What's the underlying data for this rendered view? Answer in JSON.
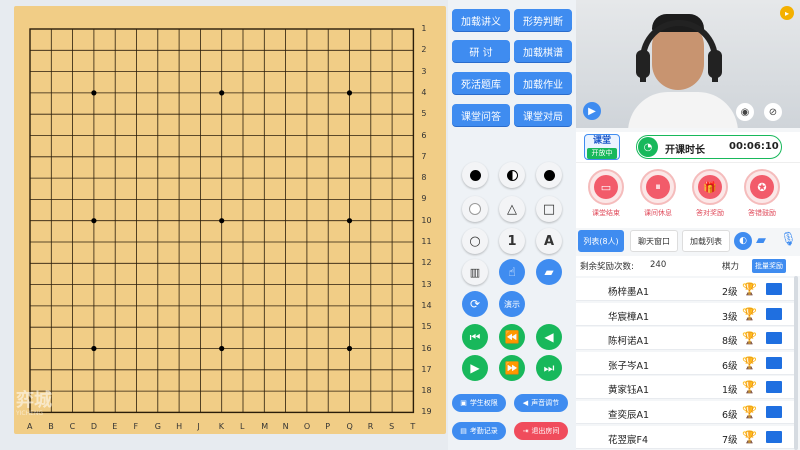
{
  "board": {
    "columns": [
      "A",
      "B",
      "C",
      "D",
      "E",
      "F",
      "G",
      "H",
      "J",
      "K",
      "L",
      "M",
      "N",
      "O",
      "P",
      "Q",
      "R",
      "S",
      "T"
    ],
    "rows": [
      "1",
      "2",
      "3",
      "4",
      "5",
      "6",
      "7",
      "8",
      "9",
      "10",
      "11",
      "12",
      "13",
      "14",
      "15",
      "16",
      "17",
      "18",
      "19"
    ],
    "hoshi": [
      "D4",
      "K4",
      "Q4",
      "D10",
      "K10",
      "Q10",
      "D16",
      "K16",
      "Q16"
    ],
    "colors": {
      "wood": "#f1cd86",
      "line": "#2a1d0a"
    }
  },
  "controls": {
    "buttons": [
      {
        "label": "加载讲义"
      },
      {
        "label": "形势判断"
      },
      {
        "label": "研 讨"
      },
      {
        "label": "加载棋谱"
      },
      {
        "label": "死活题库"
      },
      {
        "label": "加载作业"
      },
      {
        "label": "课堂问答"
      },
      {
        "label": "课堂对局"
      }
    ],
    "tools": {
      "black_stone_icon": "black-stone-icon",
      "alternate_icon": "alternate-stones-icon",
      "white_stone_icon": "white-stone-icon",
      "circle_marker": "●",
      "triangle_marker": "△",
      "square_marker": "□",
      "ring_marker": "○",
      "number_marker": "1",
      "letter_marker": "A",
      "demo_label": "演示"
    },
    "bottom": {
      "permissions": "学生权限",
      "volume": "声音调节",
      "attendance": "考勤记录",
      "exit": "退出房间"
    }
  },
  "video": {
    "logo_text": "弈城围棋",
    "logo_sub": "YICHENG"
  },
  "status": {
    "classroom_label": "课堂",
    "open_label": "开放中",
    "timer_label": "开课时长",
    "timer_value": "00:06:10"
  },
  "actions": [
    {
      "label": "课堂结束"
    },
    {
      "label": "课间休息"
    },
    {
      "label": "答对奖励"
    },
    {
      "label": "答错鼓励"
    }
  ],
  "tabs": [
    {
      "label": "列表(8人)"
    },
    {
      "label": "聊天窗口"
    },
    {
      "label": "加载列表"
    }
  ],
  "rewards": {
    "label": "剩余奖励次数:",
    "value": "240",
    "strength_label": "棋力",
    "batch_button": "批量奖励"
  },
  "students": [
    {
      "name": "杨梓墨A1",
      "level": "2级"
    },
    {
      "name": "华宸樟A1",
      "level": "3级"
    },
    {
      "name": "陈柯诺A1",
      "level": "8级"
    },
    {
      "name": "张子岑A1",
      "level": "6级"
    },
    {
      "name": "黄家钰A1",
      "level": "1级"
    },
    {
      "name": "查奕辰A1",
      "level": "6级"
    },
    {
      "name": "花翌宸F4",
      "level": "7级"
    }
  ]
}
